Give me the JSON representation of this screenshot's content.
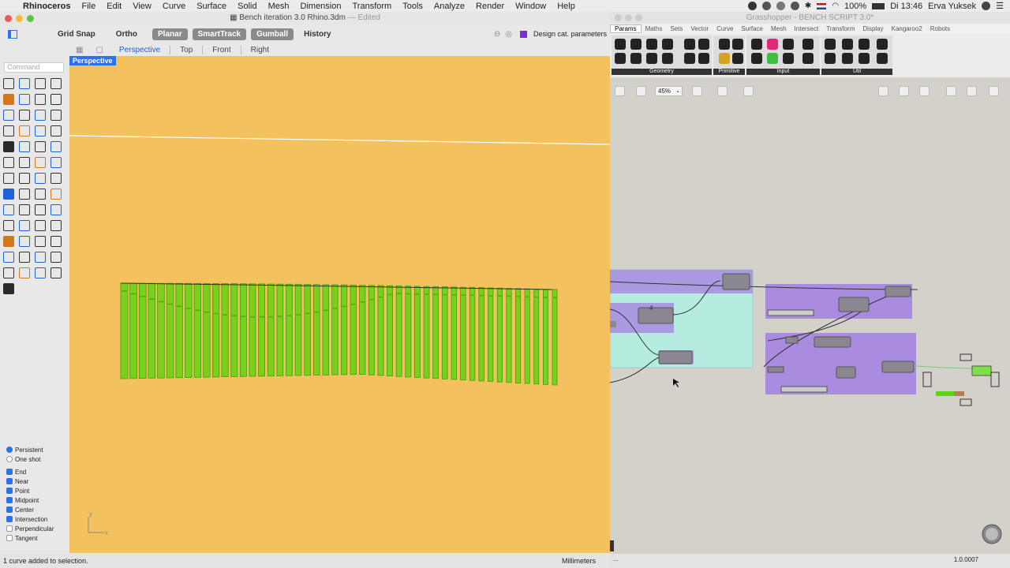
{
  "menubar": {
    "app": "Rhinoceros",
    "items": [
      "File",
      "Edit",
      "View",
      "Curve",
      "Surface",
      "Solid",
      "Mesh",
      "Dimension",
      "Transform",
      "Tools",
      "Analyze",
      "Render",
      "Window",
      "Help"
    ],
    "battery": "100%",
    "clock": "Di 13:46",
    "user": "Erva Yuksek"
  },
  "rhino": {
    "title": "Bench iteration 3.0 Rhino.3dm",
    "title_suffix": "— Edited",
    "toolbar": {
      "grid_snap": "Grid Snap",
      "ortho": "Ortho",
      "planar": "Planar",
      "smarttrack": "SmartTrack",
      "gumball": "Gumball",
      "history": "History",
      "design_param": "Design cat. parameters"
    },
    "viewport_tabs": [
      "Perspective",
      "Top",
      "Front",
      "Right"
    ],
    "command_placeholder": "Command",
    "viewport_label": "Perspective",
    "axis_y": "y",
    "axis_x": "x",
    "osnap": {
      "persistent": "Persistent",
      "one_shot": "One shot",
      "items": [
        {
          "label": "End",
          "checked": true
        },
        {
          "label": "Near",
          "checked": true
        },
        {
          "label": "Point",
          "checked": true
        },
        {
          "label": "Midpoint",
          "checked": true
        },
        {
          "label": "Center",
          "checked": true
        },
        {
          "label": "Intersection",
          "checked": true
        },
        {
          "label": "Perpendicular",
          "checked": false
        },
        {
          "label": "Tangent",
          "checked": false
        }
      ]
    },
    "status_message": "1 curve added to selection.",
    "units": "Millimeters"
  },
  "grasshopper": {
    "title": "Grasshopper - BENCH SCRIPT 3.0*",
    "tabs": [
      "Params",
      "Maths",
      "Sets",
      "Vector",
      "Curve",
      "Surface",
      "Mesh",
      "Intersect",
      "Transform",
      "Display",
      "Kangaroo2",
      "Robots"
    ],
    "ribbon_groups": [
      "Geometry",
      "Primitive",
      "Input",
      "Util"
    ],
    "zoom": "45%",
    "slider_value": "4",
    "status_left": "...",
    "version": "1.0.0007"
  },
  "colors": {
    "viewport_bg": "#f3c15e",
    "bench_green": "#5ed30f",
    "gh_canvas": "#d4d1ca",
    "group_purple": "#a98be0",
    "group_cyan": "#b6ece0",
    "accent_blue": "#2a73e8"
  }
}
